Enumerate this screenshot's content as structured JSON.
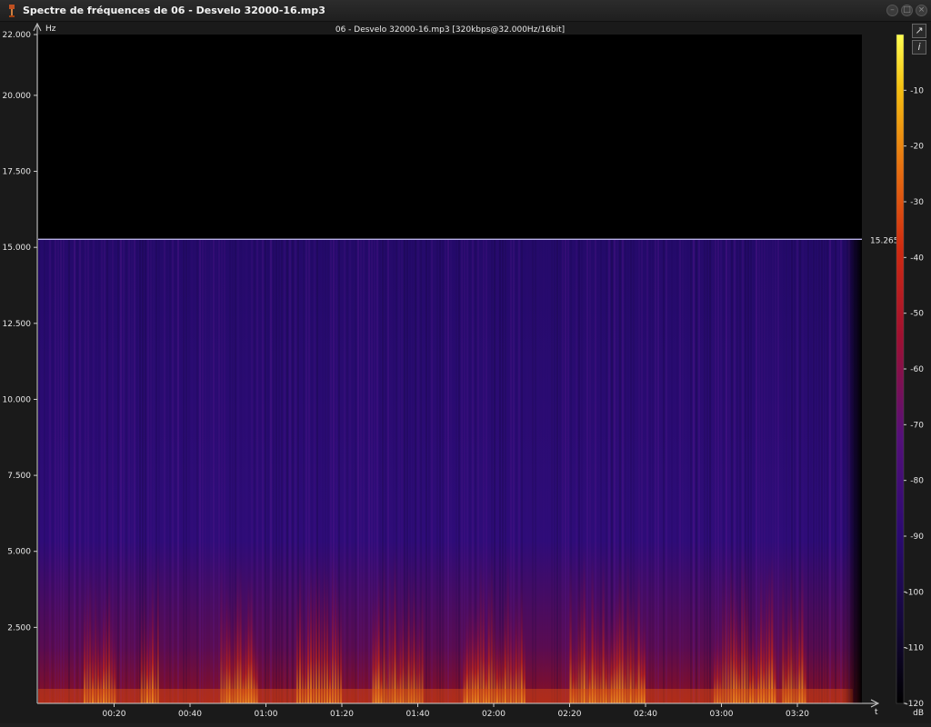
{
  "window": {
    "title": "Spectre de fréquences de 06 - Desvelo 32000-16.mp3",
    "icon": "app-icon",
    "buttons": [
      "minimize-button",
      "maximize-button",
      "close-button"
    ]
  },
  "chart_data": {
    "type": "heatmap",
    "title": "06 - Desvelo 32000-16.mp3 [320kbps@32.000Hz/16bit]",
    "ylabel": "Hz",
    "xlabel": "t",
    "ylim": [
      0,
      22000
    ],
    "y_ticks": [
      "22.000",
      "20.000",
      "17.500",
      "15.000",
      "12.500",
      "10.000",
      "7.500",
      "5.000",
      "2.500"
    ],
    "y_tick_values": [
      22000,
      20000,
      17500,
      15000,
      12500,
      10000,
      7500,
      5000,
      2500
    ],
    "x_ticks": [
      "00:20",
      "00:40",
      "01:00",
      "01:20",
      "01:40",
      "02:00",
      "02:20",
      "02:40",
      "03:00",
      "03:20"
    ],
    "x_tick_seconds": [
      20,
      40,
      60,
      80,
      100,
      120,
      140,
      160,
      180,
      200
    ],
    "duration_seconds": 217,
    "cutoff_hz": 15265,
    "cutoff_label": "15.265",
    "colorbar": {
      "unit": "dB",
      "ticks": [
        "-10",
        "-20",
        "-30",
        "-40",
        "-50",
        "-60",
        "-70",
        "-80",
        "-90",
        "-100",
        "-110",
        "-120"
      ],
      "range": [
        -120,
        0
      ],
      "colors": [
        "#000000",
        "#1a0a55",
        "#3a0a8a",
        "#8a0a40",
        "#d02010",
        "#f07010",
        "#f8d010",
        "#ffff60"
      ]
    },
    "loud_segments_seconds": [
      [
        12,
        20
      ],
      [
        27,
        32
      ],
      [
        48,
        58
      ],
      [
        68,
        80
      ],
      [
        88,
        101
      ],
      [
        112,
        128
      ],
      [
        140,
        160
      ],
      [
        178,
        194
      ],
      [
        196,
        202
      ]
    ]
  },
  "side_buttons": [
    "export-icon",
    "info-icon"
  ]
}
